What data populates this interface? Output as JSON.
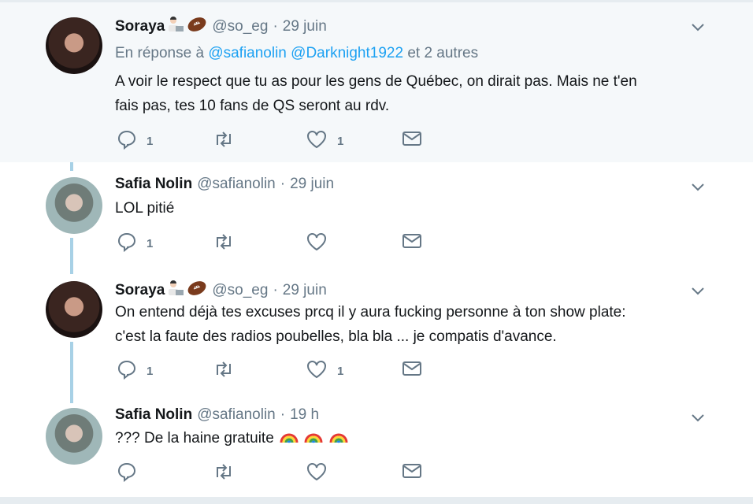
{
  "tweets": [
    {
      "author": "Soraya",
      "author_emojis": [
        "technologist-icon",
        "football-icon"
      ],
      "handle": "@so_eg",
      "separator": "·",
      "time": "29 juin",
      "reply_prefix": "En réponse à",
      "reply_mention_1": "@safianolin",
      "reply_mention_2": "@Darknight1922",
      "reply_suffix": "et 2 autres",
      "text_line_1": "A voir le respect que tu as pour les gens de Québec, on dirait pas. Mais ne t'en",
      "text_line_2": "fais pas, tes 10 fans de QS seront au rdv.",
      "reply_count": "1",
      "retweet_count": "",
      "like_count": "1"
    },
    {
      "author": "Safia Nolin",
      "handle": "@safianolin",
      "separator": "·",
      "time": "29 juin",
      "text_line_1": "LOL pitié",
      "reply_count": "1",
      "retweet_count": "",
      "like_count": ""
    },
    {
      "author": "Soraya",
      "author_emojis": [
        "technologist-icon",
        "football-icon"
      ],
      "handle": "@so_eg",
      "separator": "·",
      "time": "29 juin",
      "text_line_1": "On entend déjà tes excuses prcq il y aura fucking personne à ton show plate:",
      "text_line_2": "c'est la faute des radios poubelles, bla bla ... je compatis d'avance.",
      "reply_count": "1",
      "retweet_count": "",
      "like_count": "1"
    },
    {
      "author": "Safia Nolin",
      "handle": "@safianolin",
      "separator": "·",
      "time": "19 h",
      "text_line_1": "??? De la haine gratuite",
      "text_emojis": [
        "rainbow-icon",
        "rainbow-icon",
        "rainbow-icon"
      ],
      "reply_count": "",
      "retweet_count": "",
      "like_count": ""
    }
  ],
  "colors": {
    "highlight_bg": "#f5f8fa",
    "thread_line": "#a8d1e6",
    "link": "#1da1f2",
    "muted": "#657786"
  }
}
